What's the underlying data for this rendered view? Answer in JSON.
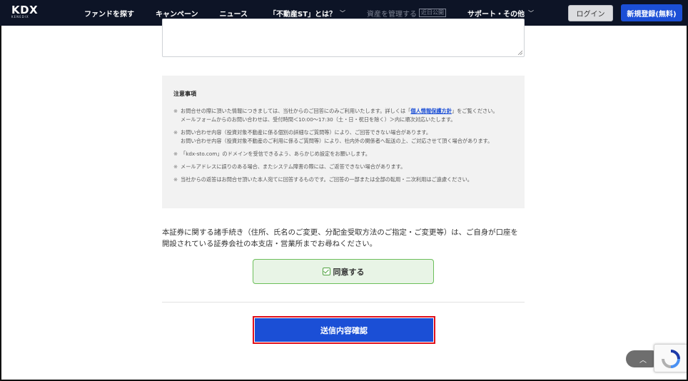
{
  "header": {
    "logo": "KDX",
    "logo_sub": "KENEDIX",
    "nav": [
      {
        "label": "ファンドを探す"
      },
      {
        "label": "キャンペーン"
      },
      {
        "label": "ニュース"
      },
      {
        "label": "「不動産ST」とは？"
      },
      {
        "label": "資産を管理する",
        "badge": "近日公開"
      },
      {
        "label": "サポート・その他"
      }
    ],
    "login_label": "ログイン",
    "register_label": "新規登録(無料)"
  },
  "notice": {
    "title": "注意事項",
    "mark": "※",
    "note1_pre": "お問合せの際に頂いた情報につきましては、当社からのご回答にのみご利用いたします。詳しくは「",
    "note1_link": "個人情報保護方針",
    "note1_post": "」をご覧ください。",
    "note1_line3": "メールフォームからのお問い合わせは、受付時間＜10:00〜17:30（土・日・祝日を除く）＞内に順次対応いたします。",
    "note2_line1": "お問い合わせ内容（投資対象不動産に係る個別の詳細なご質問等）により、ご回答できない場合があります。",
    "note2_line2": "お問い合わせ内容（投資対象不動産のご利用に係るご質問等）により、社内外の関係者へ転送の上、ご対応させて頂く場合があります。",
    "note3": "「kdx-sto.com」のドメインを受信できるよう、あらかじめ設定をお願いします。",
    "note4": "メールアドレスに誤りのある場合、またシステム障害の際には、ご返答できない場合があります。",
    "note5": "当社からの返答はお問合せ頂いた本人宛てに回答するものです。ご回答の一部または全部の転用・二次利用はご遠慮ください。"
  },
  "procedure_line1": "本証券に関する諸手続き（住所、氏名のご変更、分配金受取方法のご指定・ご変更等）は、ご自身が口座を",
  "procedure_line2": "開設されている証券会社の本支店・営業所までお尋ねください。",
  "agree_label": "同意する",
  "submit_label": "送信内容確認",
  "back_to_top": "︿"
}
